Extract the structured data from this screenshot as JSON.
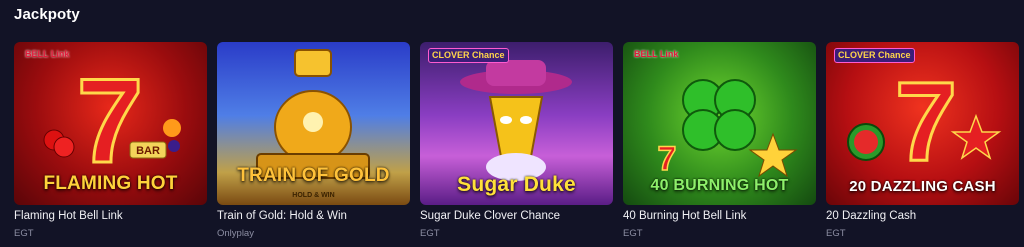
{
  "section": {
    "title": "Jackpoty"
  },
  "games": [
    {
      "name": "Flaming Hot Bell Link",
      "provider": "EGT",
      "logo": "FLAMING HOT",
      "badge": "BELL Link",
      "logo_color": "#ffd23a",
      "bg": "#8b0a12"
    },
    {
      "name": "Train of Gold: Hold & Win",
      "provider": "Onlyplay",
      "logo": "TRAIN OF GOLD",
      "sub": "HOLD & WIN",
      "logo_color": "#ffc23a",
      "bg": "#1f4bb8"
    },
    {
      "name": "Sugar Duke Clover Chance",
      "provider": "EGT",
      "logo": "Sugar Duke",
      "badge": "CLOVER Chance",
      "logo_color": "#ffe13a",
      "bg": "#7a2ea6"
    },
    {
      "name": "40 Burning Hot Bell Link",
      "provider": "EGT",
      "logo": "40 BURNING HOT",
      "badge": "BELL Link",
      "logo_color": "#8ef06a",
      "bg": "#1f6f1e"
    },
    {
      "name": "20 Dazzling Cash",
      "provider": "EGT",
      "logo": "20 DAZZLING CASH",
      "badge": "CLOVER Chance",
      "logo_color": "#ffffff",
      "bg": "#b00d14"
    }
  ]
}
